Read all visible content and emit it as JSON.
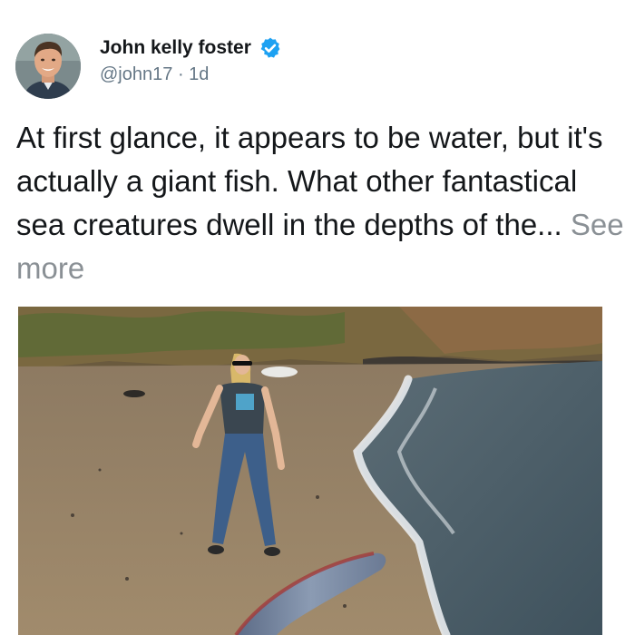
{
  "author": {
    "display_name": "John kelly foster",
    "verified": true,
    "handle": "@john17",
    "separator": "·",
    "time": "1d",
    "avatar_icon": "profile-photo"
  },
  "tweet": {
    "text": "At first glance, it appears to be water, but it's actually a giant fish. What other fantastical sea creatures dwell in the depths of the...",
    "see_more": "See more"
  },
  "media": {
    "kind": "photo",
    "alt_icon": "beach-oarfish-photo"
  },
  "colors": {
    "verified_blue": "#1da1f2",
    "text_primary": "#14171a",
    "text_secondary": "#657786",
    "see_more": "#8a9095"
  }
}
